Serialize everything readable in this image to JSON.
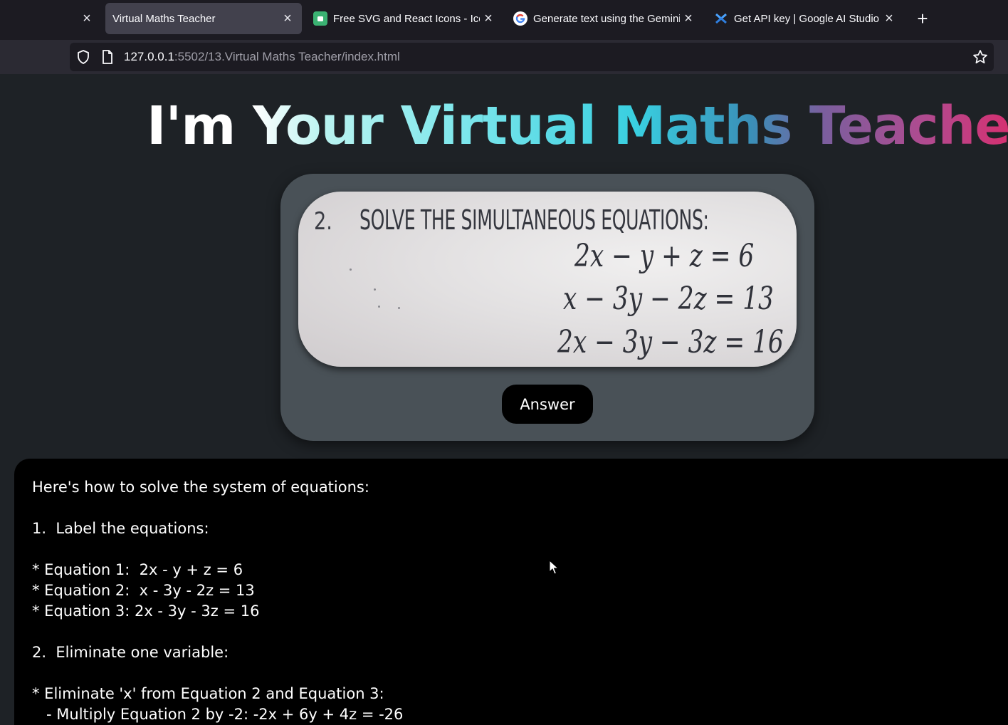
{
  "browser": {
    "tabs": [
      {
        "title": "",
        "active": false
      },
      {
        "title": "Virtual Maths Teacher",
        "active": true
      },
      {
        "title": "Free SVG and React Icons - Icon",
        "active": false
      },
      {
        "title": "Generate text using the Gemini",
        "active": false
      },
      {
        "title": "Get API key | Google AI Studio",
        "active": false
      }
    ],
    "url_host": "127.0.0.1",
    "url_path": ":5502/13.Virtual Maths Teacher/index.html"
  },
  "page": {
    "heading": "I'm Your Virtual Maths Teacher",
    "question": {
      "number": "2.",
      "title": "SOLVE THE SIMULTANEOUS EQUATIONS:",
      "equations": [
        "2x − y + z = 6",
        "x − 3y − 2z = 13",
        "2x − 3y − 3z = 16"
      ]
    },
    "answer_button": "Answer",
    "output_lines": [
      "Here's how to solve the system of equations:",
      "",
      "1.  Label the equations:",
      "",
      "* Equation 1:  2x - y + z = 6",
      "* Equation 2:  x - 3y - 2z = 13",
      "* Equation 3: 2x - 3y - 3z = 16",
      "",
      "2.  Eliminate one variable:",
      "",
      "* Eliminate 'x' from Equation 2 and Equation 3:",
      "   - Multiply Equation 2 by -2: -2x + 6y + 4z = -26"
    ]
  },
  "colors": {
    "tab_bar": "#1c1b22",
    "nav_bar": "#2b2a33",
    "page_bg": "#1e2226",
    "card": "#495157",
    "output_bg": "#000000"
  }
}
